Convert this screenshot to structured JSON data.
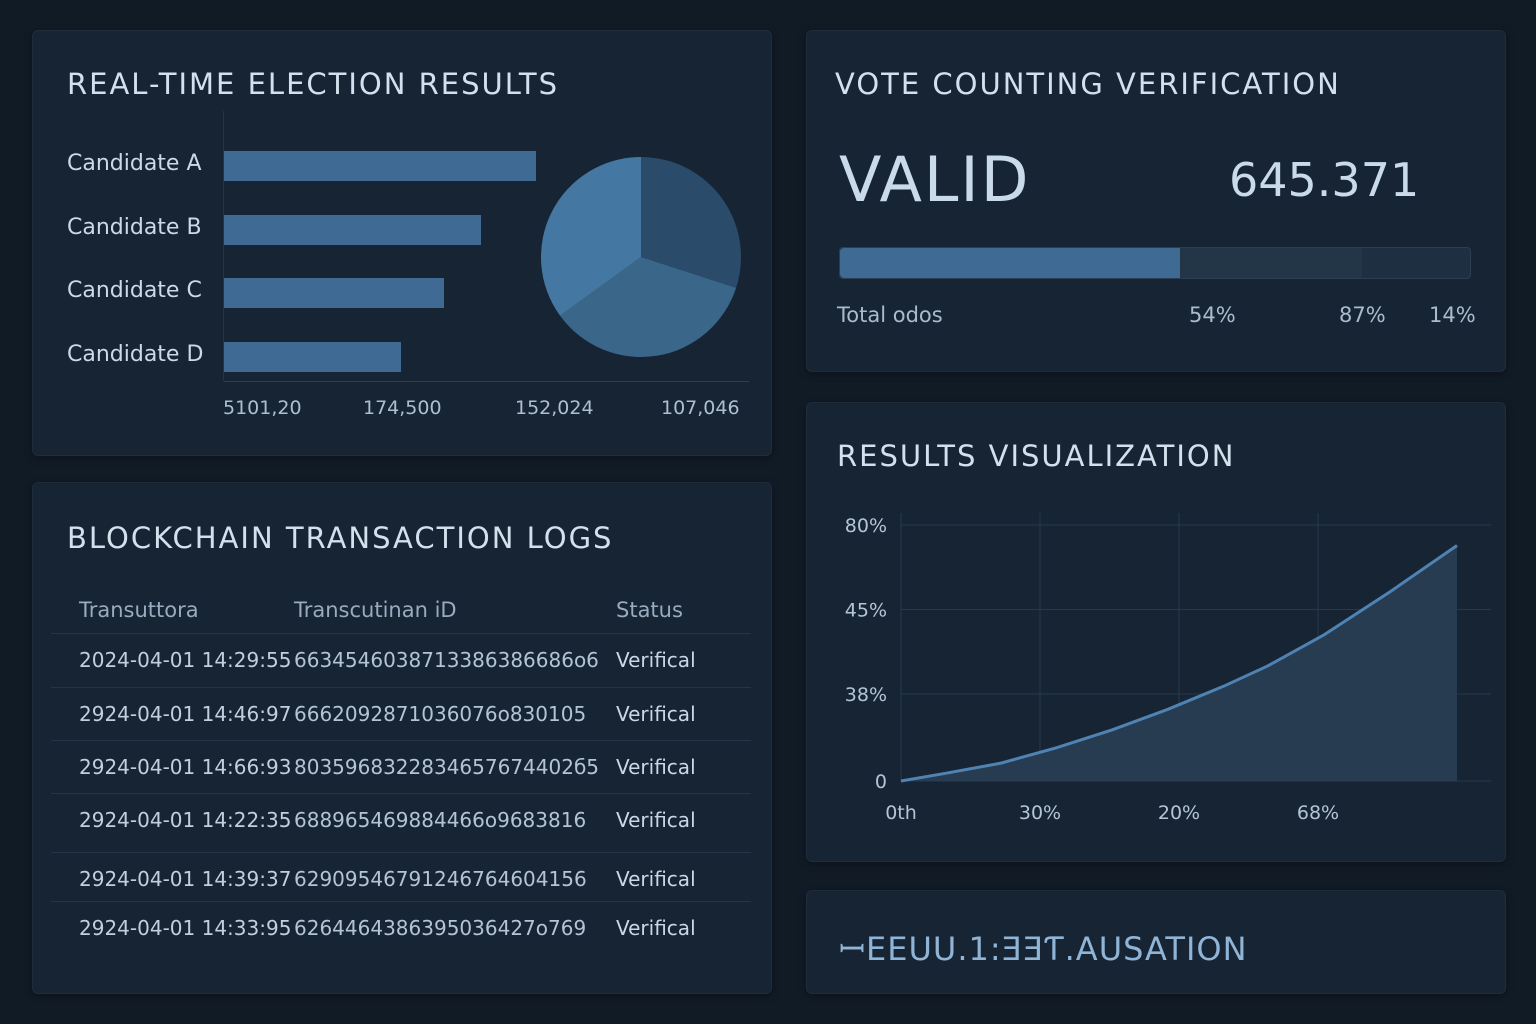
{
  "colors": {
    "accent": "#3f6a93",
    "panel": "#172433",
    "background": "#111b26"
  },
  "election": {
    "title": "REAL-TIME ELECTION RESULTS",
    "candidates": [
      "Candidate A",
      "Candidate B",
      "Candidate C",
      "Candidate D"
    ],
    "x_ticks": [
      "5101,20",
      "174,500",
      "152,024",
      "107,046"
    ]
  },
  "verification": {
    "title": "VOTE COUNTING VERIFICATION",
    "status": "VALID",
    "count": "645.371",
    "progress_fraction": 0.54,
    "labels": {
      "total": "Total odos",
      "p1": "54%",
      "p2": "87%",
      "p3": "14%"
    }
  },
  "logs": {
    "title": "BLOCKCHAIN TRANSACTION LOGS",
    "headers": [
      "Transuttora",
      "Transcutinan iD",
      "Status"
    ],
    "rows": [
      [
        "2024-04-01 14:29:55",
        "6634546038713386386686o6",
        "Verifical"
      ],
      [
        "2924-04-01 14:46:97",
        "6662092871036076o830105",
        "Verifical"
      ],
      [
        "2924-04-01 14:66:93",
        "8035968322834657674402б5",
        "Verifical"
      ],
      [
        "2924-04-01 14:22:35",
        "688965469884466o9683816",
        "Verifical"
      ],
      [
        "2924-04-01 14:39:37",
        "62909546791246764604156",
        "Verifical"
      ],
      [
        "2924-04-01 14:33:95",
        "6264464386395036427o769",
        "Verifical"
      ]
    ]
  },
  "results_vis": {
    "title": "RESULTS VISUALIZATION"
  },
  "footer": {
    "text": "ꟷEEUU.1:ƎƎƬ.AUSATION"
  },
  "chart_data": [
    {
      "type": "bar",
      "categories": [
        "Candidate A",
        "Candidate B",
        "Candidate C",
        "Candidate D"
      ],
      "values": [
        5101.2,
        4200,
        3600,
        2900
      ],
      "x_tick_labels": [
        "5101,20",
        "174,500",
        "152,024",
        "107,046"
      ]
    },
    {
      "type": "pie",
      "values": [
        30,
        35,
        35
      ]
    },
    {
      "type": "area",
      "y_tick_labels": [
        "80%",
        "45%",
        "38%",
        "0"
      ],
      "x_tick_labels": [
        "0th",
        "30%",
        "20%",
        "68%"
      ],
      "x": [
        0,
        0.08,
        0.18,
        0.28,
        0.38,
        0.48,
        0.58,
        0.66,
        0.76,
        0.88,
        1.0
      ],
      "y": [
        0,
        0.03,
        0.07,
        0.13,
        0.2,
        0.28,
        0.37,
        0.45,
        0.57,
        0.74,
        0.92
      ],
      "grid": true
    }
  ]
}
